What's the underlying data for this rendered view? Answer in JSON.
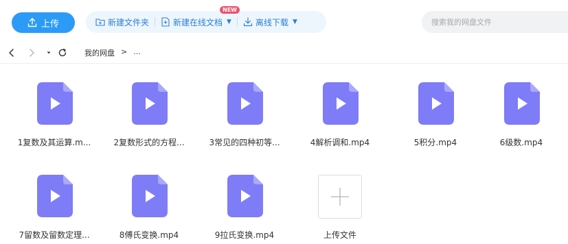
{
  "toolbar": {
    "upload_label": "上传",
    "new_folder_label": "新建文件夹",
    "new_doc_label": "新建在线文档",
    "new_badge": "NEW",
    "offline_download_label": "离线下载"
  },
  "search": {
    "placeholder": "搜索我的网盘文件"
  },
  "breadcrumb": {
    "root": "我的网盘",
    "separator": ">",
    "more": "..."
  },
  "files": [
    {
      "name": "1复数及其运算.m..."
    },
    {
      "name": "2复数形式的方程..."
    },
    {
      "name": "3常见的四种初等..."
    },
    {
      "name": "4解析调和.mp4"
    },
    {
      "name": "5积分.mp4"
    },
    {
      "name": "6级数.mp4"
    },
    {
      "name": "7留数及留数定理..."
    },
    {
      "name": "8傅氏变换.mp4"
    },
    {
      "name": "9拉氏变换.mp4"
    }
  ],
  "upload_tile": {
    "label": "上传文件"
  },
  "colors": {
    "accent": "#2b9bf7",
    "action_text": "#2a80d7",
    "file_icon": "#7e7cf7",
    "badge": "#f0516b"
  }
}
